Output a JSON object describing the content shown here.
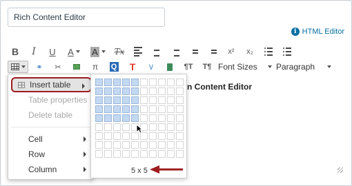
{
  "title_input": {
    "value": "Rich Content Editor"
  },
  "html_editor_link": "HTML Editor",
  "toolbar": {
    "bold": "B",
    "italic": "I",
    "underline": "U",
    "text_color": "A",
    "bg_color": "A",
    "clear_format": "Tx",
    "superscript": "x²",
    "subscript": "x₂",
    "font_sizes_label": "Font Sizes",
    "paragraph_label": "Paragraph",
    "media_t": "T",
    "quiz_q": "Q",
    "pi": "π",
    "ltr": "¶T",
    "rtl": "T¶"
  },
  "content_text": "n Content Editor",
  "table_menu": {
    "insert_table": "Insert table",
    "table_properties": "Table properties",
    "delete_table": "Delete table",
    "cell": "Cell",
    "row": "Row",
    "column": "Column"
  },
  "grid": {
    "cols": 10,
    "rows": 9,
    "selected_cols": 5,
    "selected_rows": 5,
    "size_label": "5 x 5"
  },
  "colors": {
    "accent": "#0770a3",
    "highlight_border": "#9e1b1f",
    "cell_selected": "#c3d9f2",
    "annotation_arrow": "#9e1b1f"
  }
}
